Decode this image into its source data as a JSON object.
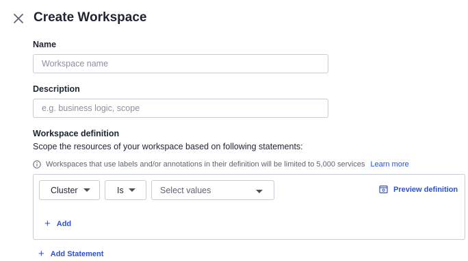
{
  "header": {
    "close_icon": "close-icon",
    "title": "Create Workspace"
  },
  "form": {
    "name": {
      "label": "Name",
      "value": "",
      "placeholder": "Workspace name"
    },
    "description": {
      "label": "Description",
      "value": "",
      "placeholder": "e.g. business logic, scope"
    },
    "definition": {
      "label": "Workspace definition",
      "subtitle": "Scope the resources of your workspace based on following statements:",
      "info_icon": "info-icon",
      "info_text": "Workspaces that use labels and/or annotations in their definition will be limited to 5,000 services",
      "learn_more": "Learn more"
    }
  },
  "statement": {
    "resource_select": {
      "value": "Cluster",
      "icon": "chevron-down-icon"
    },
    "operator_select": {
      "value": "Is",
      "icon": "chevron-down-icon"
    },
    "values_select": {
      "placeholder": "Select values",
      "icon": "chevron-down-icon"
    },
    "preview": {
      "label": "Preview definition",
      "icon": "preview-icon"
    },
    "add": {
      "label": "Add",
      "icon": "plus-icon"
    }
  },
  "add_statement": {
    "label": "Add Statement",
    "icon": "plus-icon"
  },
  "colors": {
    "text": "#1f2433",
    "muted": "#5f6472",
    "placeholder": "#8c909c",
    "border": "#c9ccd4",
    "accent": "#2c4fd6"
  }
}
